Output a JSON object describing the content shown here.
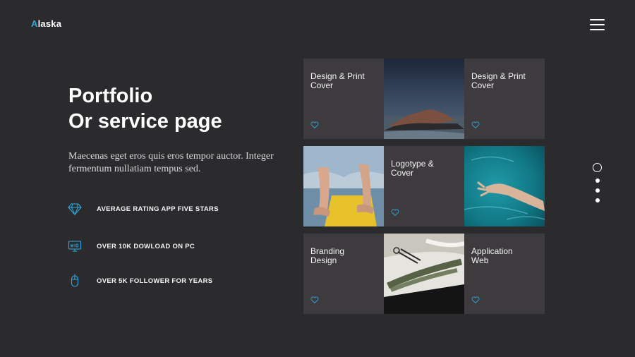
{
  "brand": {
    "initial": "A",
    "rest": "laska"
  },
  "hero": {
    "title_line1": "Portfolio",
    "title_line2": "Or service page",
    "description": "Maecenas eget eros quis eros tempor auctor. Integer fermentum nullatiam tempus sed."
  },
  "stats": [
    {
      "icon": "diamond-icon",
      "label": "AVERAGE RATING APP FIVE STARS"
    },
    {
      "icon": "monitor-icon",
      "label": "OVER 10K DOWLOAD  ON PC"
    },
    {
      "icon": "mouse-icon",
      "label": "OVER 5K FOLLOWER  FOR YEARS"
    }
  ],
  "tiles": [
    {
      "title": "Design & Print\nCover"
    },
    {
      "title": "Design & Print\nCover"
    },
    {
      "title": "Logotype &\nCover"
    },
    {
      "title": "Branding\nDesign"
    },
    {
      "title": "Application\nWeb"
    }
  ],
  "colors": {
    "background": "#2b2b2d",
    "tile": "#3d3b3d",
    "accent": "#2fa8e0"
  }
}
